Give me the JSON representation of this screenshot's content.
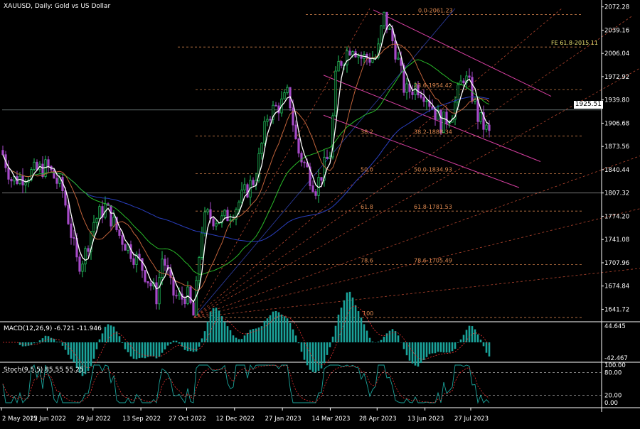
{
  "title": {
    "symbol": "XAUUSD",
    "timeframe": "Daily",
    "description": "Gold vs US Dollar"
  },
  "current_price": "1925.51",
  "colors": {
    "background": "#000000",
    "bull": "#22c55e",
    "bear": "#a64ac9",
    "ma_fast": "#ffffff",
    "ma_mid": "#c0623a",
    "ma_slow": "#29b929",
    "ma_long": "#2a3fbf",
    "fib": "#e08a50",
    "channel": "#d63fa0",
    "fan": "#e0573a",
    "macd_hist": "#1aa39a",
    "macd_signal": "#e33",
    "stoch_main": "#1aa39a",
    "stoch_signal": "#e33",
    "grid": "#8a8a8a"
  },
  "chart_data": [
    {
      "type": "candlestick",
      "title": "XAUUSD, Daily:  Gold vs US Dollar",
      "ylim": [
        1625,
        2078
      ],
      "y_ticks": [
        "2072.28",
        "2039.16",
        "2006.04",
        "1972.92",
        "1939.80",
        "1906.68",
        "1873.56",
        "1840.44",
        "1807.32",
        "1774.20",
        "1741.08",
        "1707.96",
        "1674.84",
        "1641.72"
      ],
      "x_ticks": [
        "2 May 2022",
        "15 Jun 2022",
        "29 Jul 2022",
        "13 Sep 2022",
        "27 Oct 2022",
        "12 Dec 2022",
        "27 Jan 2023",
        "14 Mar 2023",
        "28 Apr 2023",
        "13 Jun 2023",
        "27 Jul 2023"
      ],
      "close_path": [
        [
          "2 May 2022",
          1868
        ],
        [
          "12 May 2022",
          1825
        ],
        [
          "15 Jun 2022",
          1845
        ],
        [
          "30 Jun 2022",
          1810
        ],
        [
          "14 Jul 2022",
          1705
        ],
        [
          "21 Jul 2022",
          1718
        ],
        [
          "29 Jul 2022",
          1765
        ],
        [
          "10 Aug 2022",
          1788
        ],
        [
          "23 Aug 2022",
          1748
        ],
        [
          "13 Sep 2022",
          1705
        ],
        [
          "28 Sep 2022",
          1660
        ],
        [
          "4 Oct 2022",
          1720
        ],
        [
          "13 Oct 2022",
          1665
        ],
        [
          "21 Oct 2022",
          1655
        ],
        [
          "27 Oct 2022",
          1665
        ],
        [
          "3 Nov 2022",
          1630
        ],
        [
          "10 Nov 2022",
          1755
        ],
        [
          "15 Nov 2022",
          1775
        ],
        [
          "30 Nov 2022",
          1768
        ],
        [
          "12 Dec 2022",
          1785
        ],
        [
          "1 Jan 2023",
          1830
        ],
        [
          "13 Jan 2023",
          1920
        ],
        [
          "27 Jan 2023",
          1935
        ],
        [
          "2 Feb 2023",
          1950
        ],
        [
          "10 Feb 2023",
          1870
        ],
        [
          "28 Feb 2023",
          1815
        ],
        [
          "14 Mar 2023",
          1865
        ],
        [
          "20 Mar 2023",
          1985
        ],
        [
          "4 Apr 2023",
          2020
        ],
        [
          "12 Apr 2023",
          2000
        ],
        [
          "28 Apr 2023",
          2000
        ],
        [
          "4 May 2023",
          2060
        ],
        [
          "15 May 2023",
          2015
        ],
        [
          "25 May 2023",
          1950
        ],
        [
          "5 Jun 2023",
          1960
        ],
        [
          "13 Jun 2023",
          1950
        ],
        [
          "29 Jun 2023",
          1905
        ],
        [
          "10 Jul 2023",
          1925
        ],
        [
          "20 Jul 2023",
          1975
        ],
        [
          "27 Jul 2023",
          1955
        ],
        [
          "3 Aug 2023",
          1915
        ],
        [
          "14 Aug 2023",
          1890
        ],
        [
          "21 Aug 2023",
          1905
        ],
        [
          "24 Aug 2023",
          1925
        ]
      ],
      "horizontal_levels": [
        2061.23,
        2015.11,
        1954.42,
        1888.34,
        1834.93,
        1807.32,
        1781.53,
        1705.49,
        1630
      ],
      "fib_labels": [
        {
          "text": "0.0-2061.23",
          "price": 2061.23
        },
        {
          "text": "FE 61.8-2015.11",
          "price": 2015.11
        },
        {
          "text": "23.6-1954.42",
          "price": 1954.42
        },
        {
          "text": "38.2",
          "price": 1888.34
        },
        {
          "text": "38.2-1888.34",
          "price": 1888.34
        },
        {
          "text": "50.0",
          "price": 1834.93
        },
        {
          "text": "50.0-1834.93",
          "price": 1834.93
        },
        {
          "text": "61.8",
          "price": 1781.53
        },
        {
          "text": "61.8-1781.53",
          "price": 1781.53
        },
        {
          "text": "78.6",
          "price": 1705.49
        },
        {
          "text": "78.6-1705.49",
          "price": 1705.49
        },
        {
          "text": "100",
          "price": 1630
        }
      ]
    },
    {
      "type": "bar",
      "title": "MACD(12,26,9) -6.721 -11.946",
      "y_ticks": [
        "44.645",
        "-42.467"
      ],
      "ylim": [
        -50,
        50
      ]
    },
    {
      "type": "line",
      "title": "Stoch(9,5,5) 85.55 55.25",
      "y_ticks": [
        "100.00",
        "80.00",
        "20.00",
        "0.00"
      ],
      "ylim": [
        0,
        100
      ]
    }
  ]
}
